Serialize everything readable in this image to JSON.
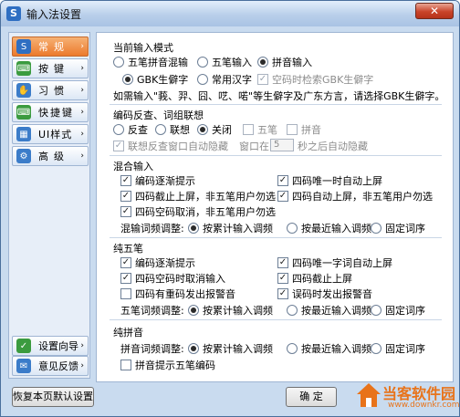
{
  "window": {
    "title": "输入法设置",
    "close_label": "✕"
  },
  "sidebar": {
    "items": [
      {
        "label": "常规",
        "icon": "pinyin-s-icon",
        "color": "#ec7a2d"
      },
      {
        "label": "按键",
        "icon": "keyboard-icon",
        "color": "#3b9b3f"
      },
      {
        "label": "习惯",
        "icon": "hands-icon",
        "color": "#3b7cc9"
      },
      {
        "label": "快捷键",
        "icon": "keyboard-shortcut-icon",
        "color": "#3b9b3f"
      },
      {
        "label": "UI样式",
        "icon": "grid-icon",
        "color": "#3b7cc9"
      },
      {
        "label": "高级",
        "icon": "gear-icon",
        "color": "#3b7cc9"
      }
    ],
    "wizard_label": "设置向导",
    "feedback_label": "意见反馈"
  },
  "section_input_mode": {
    "title": "当前输入模式",
    "wubi_pinyin": "五笔拼音混输",
    "wubi": "五笔输入",
    "pinyin": "拼音输入",
    "gbk": "GBK生僻字",
    "common": "常用汉字",
    "empty_code_gbk": "空码时检索GBK生僻字",
    "hint": "如需输入\"莪、羿、囧、呓、喏\"等生僻字及广东方言，请选择GBK生僻字。"
  },
  "section_reverse": {
    "title": "编码反查、词组联想",
    "reverse": "反查",
    "associate": "联想",
    "off": "关闭",
    "wubi": "五笔",
    "pinyin": "拼音",
    "auto_hide": "联想反查窗口自动隐藏",
    "window_in": "窗口在",
    "seconds_value": "5",
    "seconds_suffix": "秒之后自动隐藏"
  },
  "section_mixed": {
    "title": "混合输入",
    "code_hint": "编码逐渐提示",
    "four_unique": "四码唯一时自动上屏",
    "four_truncate": "四码截止上屏，非五笔用户勿选",
    "four_auto": "四码自动上屏，非五笔用户勿选",
    "four_empty_cancel": "四码空码取消，非五笔用户勿选",
    "freq_label": "混输词频调整:",
    "freq_cumulative": "按累计输入调频",
    "freq_recent": "按最近输入调频",
    "freq_fixed": "固定词序"
  },
  "section_wubi": {
    "title": "纯五笔",
    "code_hint": "编码逐渐提示",
    "four_unique_word": "四码唯一字词自动上屏",
    "four_empty_cancel": "四码空码时取消输入",
    "four_truncate": "四码截止上屏",
    "four_duplicate_beep": "四码有重码发出报警音",
    "wrong_code_beep": "误码时发出报警音",
    "freq_label": "五笔词频调整:",
    "freq_cumulative": "按累计输入调频",
    "freq_recent": "按最近输入调频",
    "freq_fixed": "固定词序"
  },
  "section_pinyin": {
    "title": "纯拼音",
    "freq_label": "拼音词频调整:",
    "freq_cumulative": "按累计输入调频",
    "freq_recent": "按最近输入调频",
    "freq_fixed": "固定词序",
    "wubi_hint": "拼音提示五笔编码"
  },
  "footer": {
    "restore_label": "恢复本页默认设置",
    "ok_label": "确 定",
    "watermark": "当客软件园",
    "watermark_url": "www.downkr.com"
  }
}
